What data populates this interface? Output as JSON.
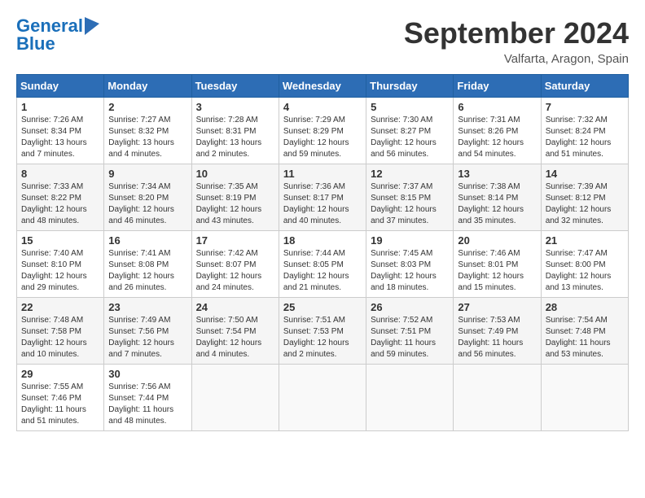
{
  "header": {
    "logo_line1": "General",
    "logo_line2": "Blue",
    "month": "September 2024",
    "location": "Valfarta, Aragon, Spain"
  },
  "weekdays": [
    "Sunday",
    "Monday",
    "Tuesday",
    "Wednesday",
    "Thursday",
    "Friday",
    "Saturday"
  ],
  "weeks": [
    [
      {
        "day": "1",
        "info": "Sunrise: 7:26 AM\nSunset: 8:34 PM\nDaylight: 13 hours\nand 7 minutes."
      },
      {
        "day": "2",
        "info": "Sunrise: 7:27 AM\nSunset: 8:32 PM\nDaylight: 13 hours\nand 4 minutes."
      },
      {
        "day": "3",
        "info": "Sunrise: 7:28 AM\nSunset: 8:31 PM\nDaylight: 13 hours\nand 2 minutes."
      },
      {
        "day": "4",
        "info": "Sunrise: 7:29 AM\nSunset: 8:29 PM\nDaylight: 12 hours\nand 59 minutes."
      },
      {
        "day": "5",
        "info": "Sunrise: 7:30 AM\nSunset: 8:27 PM\nDaylight: 12 hours\nand 56 minutes."
      },
      {
        "day": "6",
        "info": "Sunrise: 7:31 AM\nSunset: 8:26 PM\nDaylight: 12 hours\nand 54 minutes."
      },
      {
        "day": "7",
        "info": "Sunrise: 7:32 AM\nSunset: 8:24 PM\nDaylight: 12 hours\nand 51 minutes."
      }
    ],
    [
      {
        "day": "8",
        "info": "Sunrise: 7:33 AM\nSunset: 8:22 PM\nDaylight: 12 hours\nand 48 minutes."
      },
      {
        "day": "9",
        "info": "Sunrise: 7:34 AM\nSunset: 8:20 PM\nDaylight: 12 hours\nand 46 minutes."
      },
      {
        "day": "10",
        "info": "Sunrise: 7:35 AM\nSunset: 8:19 PM\nDaylight: 12 hours\nand 43 minutes."
      },
      {
        "day": "11",
        "info": "Sunrise: 7:36 AM\nSunset: 8:17 PM\nDaylight: 12 hours\nand 40 minutes."
      },
      {
        "day": "12",
        "info": "Sunrise: 7:37 AM\nSunset: 8:15 PM\nDaylight: 12 hours\nand 37 minutes."
      },
      {
        "day": "13",
        "info": "Sunrise: 7:38 AM\nSunset: 8:14 PM\nDaylight: 12 hours\nand 35 minutes."
      },
      {
        "day": "14",
        "info": "Sunrise: 7:39 AM\nSunset: 8:12 PM\nDaylight: 12 hours\nand 32 minutes."
      }
    ],
    [
      {
        "day": "15",
        "info": "Sunrise: 7:40 AM\nSunset: 8:10 PM\nDaylight: 12 hours\nand 29 minutes."
      },
      {
        "day": "16",
        "info": "Sunrise: 7:41 AM\nSunset: 8:08 PM\nDaylight: 12 hours\nand 26 minutes."
      },
      {
        "day": "17",
        "info": "Sunrise: 7:42 AM\nSunset: 8:07 PM\nDaylight: 12 hours\nand 24 minutes."
      },
      {
        "day": "18",
        "info": "Sunrise: 7:44 AM\nSunset: 8:05 PM\nDaylight: 12 hours\nand 21 minutes."
      },
      {
        "day": "19",
        "info": "Sunrise: 7:45 AM\nSunset: 8:03 PM\nDaylight: 12 hours\nand 18 minutes."
      },
      {
        "day": "20",
        "info": "Sunrise: 7:46 AM\nSunset: 8:01 PM\nDaylight: 12 hours\nand 15 minutes."
      },
      {
        "day": "21",
        "info": "Sunrise: 7:47 AM\nSunset: 8:00 PM\nDaylight: 12 hours\nand 13 minutes."
      }
    ],
    [
      {
        "day": "22",
        "info": "Sunrise: 7:48 AM\nSunset: 7:58 PM\nDaylight: 12 hours\nand 10 minutes."
      },
      {
        "day": "23",
        "info": "Sunrise: 7:49 AM\nSunset: 7:56 PM\nDaylight: 12 hours\nand 7 minutes."
      },
      {
        "day": "24",
        "info": "Sunrise: 7:50 AM\nSunset: 7:54 PM\nDaylight: 12 hours\nand 4 minutes."
      },
      {
        "day": "25",
        "info": "Sunrise: 7:51 AM\nSunset: 7:53 PM\nDaylight: 12 hours\nand 2 minutes."
      },
      {
        "day": "26",
        "info": "Sunrise: 7:52 AM\nSunset: 7:51 PM\nDaylight: 11 hours\nand 59 minutes."
      },
      {
        "day": "27",
        "info": "Sunrise: 7:53 AM\nSunset: 7:49 PM\nDaylight: 11 hours\nand 56 minutes."
      },
      {
        "day": "28",
        "info": "Sunrise: 7:54 AM\nSunset: 7:48 PM\nDaylight: 11 hours\nand 53 minutes."
      }
    ],
    [
      {
        "day": "29",
        "info": "Sunrise: 7:55 AM\nSunset: 7:46 PM\nDaylight: 11 hours\nand 51 minutes."
      },
      {
        "day": "30",
        "info": "Sunrise: 7:56 AM\nSunset: 7:44 PM\nDaylight: 11 hours\nand 48 minutes."
      },
      {
        "day": "",
        "info": ""
      },
      {
        "day": "",
        "info": ""
      },
      {
        "day": "",
        "info": ""
      },
      {
        "day": "",
        "info": ""
      },
      {
        "day": "",
        "info": ""
      }
    ]
  ]
}
